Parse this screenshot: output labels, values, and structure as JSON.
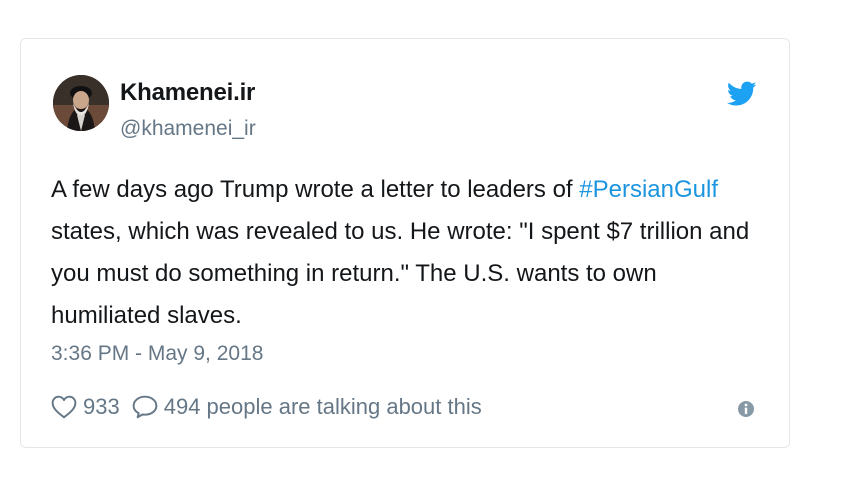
{
  "tweet": {
    "display_name": "Khamenei.ir",
    "handle": "@khamenei_ir",
    "text_before_hashtag": "A few days ago Trump wrote a letter to leaders of ",
    "hashtag": "#PersianGulf",
    "text_after_hashtag": " states, which was revealed to us. He wrote: \"I spent $7 trillion and you must do something in return.\" The U.S. wants to own humiliated slaves.",
    "timestamp": "3:36 PM - May 9, 2018",
    "like_count": "933",
    "talking_text": "494 people are talking about this"
  },
  "icons": {
    "brand": "twitter-bird-icon",
    "like": "heart-icon",
    "reply": "speech-bubble-icon",
    "info": "info-icon"
  },
  "colors": {
    "twitter_blue": "#1da1f2",
    "hashtag": "#1b95e0",
    "text": "#14171a",
    "secondary": "#657786"
  }
}
